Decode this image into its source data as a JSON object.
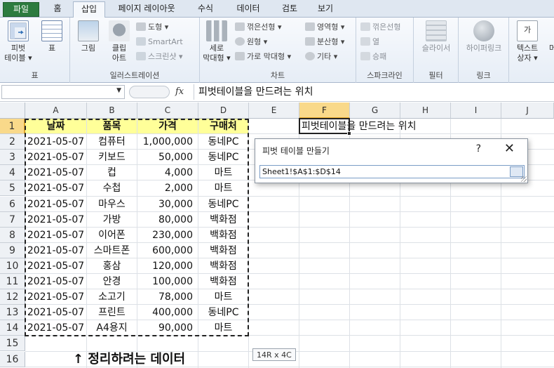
{
  "tabs": [
    {
      "label": "파일",
      "key": "file"
    },
    {
      "label": "홈",
      "key": "home"
    },
    {
      "label": "삽입",
      "key": "insert"
    },
    {
      "label": "페이지 레이아웃",
      "key": "layout"
    },
    {
      "label": "수식",
      "key": "formula"
    },
    {
      "label": "데이터",
      "key": "data"
    },
    {
      "label": "검토",
      "key": "review"
    },
    {
      "label": "보기",
      "key": "view"
    }
  ],
  "active_tab": "삽입",
  "ribbon": {
    "tables": {
      "label": "표",
      "pivot_line1": "피벗",
      "pivot_line2": "테이블 ▾",
      "table": "표"
    },
    "illustrations": {
      "label": "일러스트레이션",
      "picture": "그림",
      "clipart_line1": "클립",
      "clipart_line2": "아트",
      "shapes": "도형 ▾",
      "smartart": "SmartArt",
      "screenshot": "스크린샷 ▾"
    },
    "charts": {
      "label": "차트",
      "column_line1": "세로",
      "column_line2": "막대형 ▾",
      "line": "꺾은선형 ▾",
      "pie": "원형 ▾",
      "bar": "가로 막대형 ▾",
      "area": "영역형 ▾",
      "scatter": "분산형 ▾",
      "other": "기타 ▾"
    },
    "sparklines": {
      "label": "스파크라인",
      "line": "꺾은선형",
      "column": "열",
      "winloss": "승패"
    },
    "filter": {
      "label": "필터",
      "slicer": "슬라이서"
    },
    "links": {
      "label": "링크",
      "hyperlink": "하이퍼링크"
    },
    "text": {
      "textbox_line1": "텍스트",
      "textbox_line2": "상자 ▾",
      "more": "머"
    }
  },
  "formula_bar": {
    "name_box": "",
    "fx": "fx",
    "content": "피벗테이블을 만드려는 위치"
  },
  "columns": [
    "A",
    "B",
    "C",
    "D",
    "E",
    "F",
    "G",
    "H",
    "I",
    "J"
  ],
  "selected_column": "F",
  "rows": [
    "1",
    "2",
    "3",
    "4",
    "5",
    "6",
    "7",
    "8",
    "9",
    "10",
    "11",
    "12",
    "13",
    "14",
    "15",
    "16"
  ],
  "selected_row": "1",
  "table": {
    "headers": [
      "날짜",
      "품목",
      "가격",
      "구매처"
    ],
    "rows": [
      [
        "2021-05-07",
        "컴퓨터",
        "1,000,000",
        "동네PC"
      ],
      [
        "2021-05-07",
        "키보드",
        "50,000",
        "동네PC"
      ],
      [
        "2021-05-07",
        "컵",
        "4,000",
        "마트"
      ],
      [
        "2021-05-07",
        "수첩",
        "2,000",
        "마트"
      ],
      [
        "2021-05-07",
        "마우스",
        "30,000",
        "동네PC"
      ],
      [
        "2021-05-07",
        "가방",
        "80,000",
        "백화점"
      ],
      [
        "2021-05-07",
        "이어폰",
        "230,000",
        "백화점"
      ],
      [
        "2021-05-07",
        "스마트폰",
        "600,000",
        "백화점"
      ],
      [
        "2021-05-07",
        "홍삼",
        "120,000",
        "백화점"
      ],
      [
        "2021-05-07",
        "안경",
        "100,000",
        "백화점"
      ],
      [
        "2021-05-07",
        "소고기",
        "78,000",
        "마트"
      ],
      [
        "2021-05-07",
        "프린트",
        "400,000",
        "동네PC"
      ],
      [
        "2021-05-07",
        "A4용지",
        "90,000",
        "마트"
      ]
    ]
  },
  "f1_text": "피벗테이블을 만드려는 위치",
  "note_text": "↑ 정리하려는 데이터",
  "size_tip": "14R x 4C",
  "dialog": {
    "title": "피벗 테이블 만들기",
    "help": "?",
    "close": "✕",
    "range": "Sheet1!$A$1:$D$14"
  }
}
